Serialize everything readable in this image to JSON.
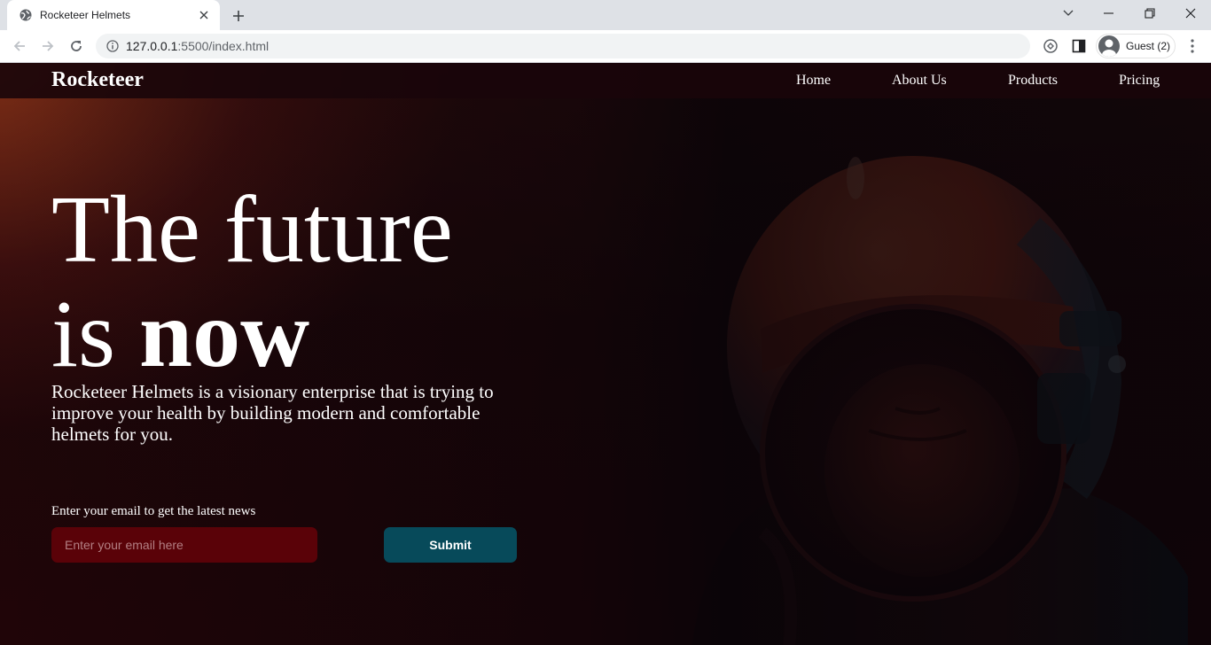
{
  "browser": {
    "tab_title": "Rocketeer Helmets",
    "url_host": "127.0.0.1",
    "url_rest": ":5500/index.html",
    "profile_label": "Guest (2)"
  },
  "nav": {
    "brand": "Rocketeer",
    "links": [
      "Home",
      "About Us",
      "Products",
      "Pricing"
    ]
  },
  "hero": {
    "title_line1": "The future",
    "title_line2_plain": "is ",
    "title_line2_bold": "now",
    "description": "Rocketeer Helmets is a visionary enterprise that is trying to improve your health by building modern and comfortable helmets for you."
  },
  "newsletter": {
    "label": "Enter your email to get the latest news",
    "placeholder": "Enter your email here",
    "submit_label": "Submit"
  },
  "colors": {
    "input_bg": "#5a0208",
    "button_bg": "#074a5a",
    "helmet_orange": "#d2492a",
    "helmet_teal": "#1e5a6e"
  },
  "icons": {
    "favicon": "globe-icon",
    "back": "back-arrow-icon",
    "forward": "forward-arrow-icon",
    "reload": "reload-icon",
    "info": "info-icon",
    "extension": "extension-icon",
    "side_panel": "side-panel-icon",
    "menu": "kebab-menu-icon"
  }
}
